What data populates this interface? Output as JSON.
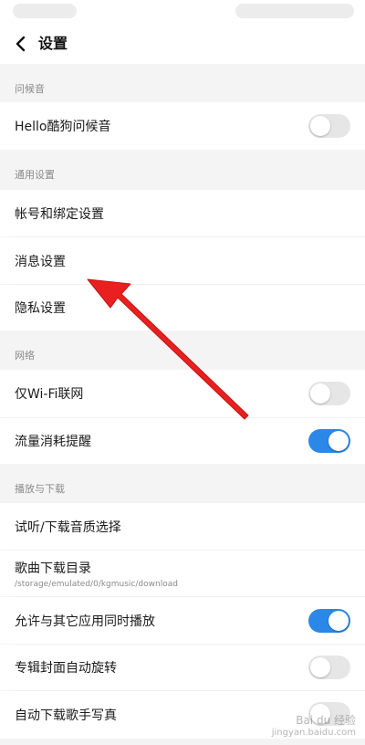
{
  "header": {
    "title": "设置"
  },
  "sections": {
    "greeting": {
      "label": "问候音",
      "items": {
        "hello_greeting": {
          "label": "Hello酷狗问候音",
          "toggle": "off"
        }
      }
    },
    "general": {
      "label": "通用设置",
      "items": {
        "account": {
          "label": "帐号和绑定设置"
        },
        "messages": {
          "label": "消息设置"
        },
        "privacy": {
          "label": "隐私设置"
        }
      }
    },
    "network": {
      "label": "网络",
      "items": {
        "wifi_only": {
          "label": "仅Wi-Fi联网",
          "toggle": "off"
        },
        "data_alert": {
          "label": "流量消耗提醒",
          "toggle": "on"
        }
      }
    },
    "playback": {
      "label": "播放与下载",
      "items": {
        "audio_quality": {
          "label": "试听/下载音质选择"
        },
        "download_dir": {
          "label": "歌曲下载目录",
          "path": "/storage/emulated/0/kgmusic/download"
        },
        "simultaneous": {
          "label": "允许与其它应用同时播放",
          "toggle": "on"
        },
        "album_rotate": {
          "label": "专辑封面自动旋转",
          "toggle": "off"
        },
        "auto_download_photo": {
          "label": "自动下载歌手写真",
          "toggle": "off"
        }
      }
    }
  },
  "colors": {
    "toggle_on": "#2b87e8",
    "toggle_off": "#e6e6e6",
    "annotation_arrow": "#e8201f"
  },
  "icons": {
    "back": "chevron-left-icon",
    "annotation": "red-arrow-annotation"
  },
  "watermark": {
    "text": "Bai du 经验",
    "sub": "jingyan.baidu.com"
  }
}
